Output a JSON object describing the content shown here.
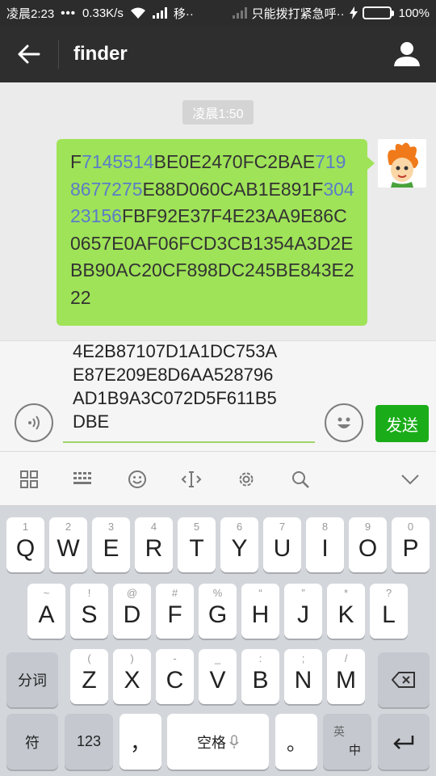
{
  "status_bar": {
    "time": "凌晨2:23",
    "dots": "•••",
    "speed": "0.33K/s",
    "carrier1": "移··",
    "carrier2": "只能拨打紧急呼··",
    "battery": "100%",
    "battery_level": 1.0
  },
  "header": {
    "title": "finder",
    "back_icon": "back-arrow-icon",
    "profile_icon": "person-icon"
  },
  "chat": {
    "timestamp": "凌晨1:50",
    "message": {
      "segments": [
        {
          "text": "F",
          "highlight": false
        },
        {
          "text": "7145514",
          "highlight": true
        },
        {
          "text": "BE0E2470FC2BAE",
          "highlight": false
        },
        {
          "text": "7198677275",
          "highlight": true
        },
        {
          "text": "E88D060CAB1E891F",
          "highlight": false
        },
        {
          "text": "30423156",
          "highlight": true
        },
        {
          "text": "FBF92E37F4E23AA9E86C0657E0AF06FCD3CB1354A3D2EBB90AC20CF898DC245BE843E222",
          "highlight": false
        }
      ],
      "bubble_color": "#9fe358",
      "highlight_color": "#5b7cc8"
    }
  },
  "input": {
    "lines": [
      "4E2B87107D1A1DC753A",
      "E87E209E8D6AA528796",
      "AD1B9A3C072D5F611B5",
      "DBE"
    ],
    "send_label": "发送",
    "accent": "#1aad19"
  },
  "keyboard_toolbar": {
    "icons": [
      "apps-grid-icon",
      "keyboard-icon",
      "smiley-icon",
      "cursor-icon",
      "settings-icon",
      "search-icon",
      "chevron-down-icon"
    ]
  },
  "keyboard": {
    "row1": [
      {
        "sub": "1",
        "key": "Q"
      },
      {
        "sub": "2",
        "key": "W"
      },
      {
        "sub": "3",
        "key": "E"
      },
      {
        "sub": "4",
        "key": "R"
      },
      {
        "sub": "5",
        "key": "T"
      },
      {
        "sub": "6",
        "key": "Y"
      },
      {
        "sub": "7",
        "key": "U"
      },
      {
        "sub": "8",
        "key": "I"
      },
      {
        "sub": "9",
        "key": "O"
      },
      {
        "sub": "0",
        "key": "P"
      }
    ],
    "row2": [
      {
        "sub": "~",
        "key": "A"
      },
      {
        "sub": "!",
        "key": "S"
      },
      {
        "sub": "@",
        "key": "D"
      },
      {
        "sub": "#",
        "key": "F"
      },
      {
        "sub": "%",
        "key": "G"
      },
      {
        "sub": "“",
        "key": "H"
      },
      {
        "sub": "”",
        "key": "J"
      },
      {
        "sub": "*",
        "key": "K"
      },
      {
        "sub": "?",
        "key": "L"
      }
    ],
    "row3": [
      {
        "sub": "(",
        "key": "Z"
      },
      {
        "sub": ")",
        "key": "X"
      },
      {
        "sub": "-",
        "key": "C"
      },
      {
        "sub": "_",
        "key": "V"
      },
      {
        "sub": ":",
        "key": "B"
      },
      {
        "sub": ";",
        "key": "N"
      },
      {
        "sub": "/",
        "key": "M"
      }
    ],
    "segment_label": "分词",
    "symbol_label": "符",
    "num_label": "123",
    "comma_label": "，",
    "space_label": "空格",
    "period_label": "。",
    "lang_top": "英",
    "lang_bottom": "中"
  }
}
